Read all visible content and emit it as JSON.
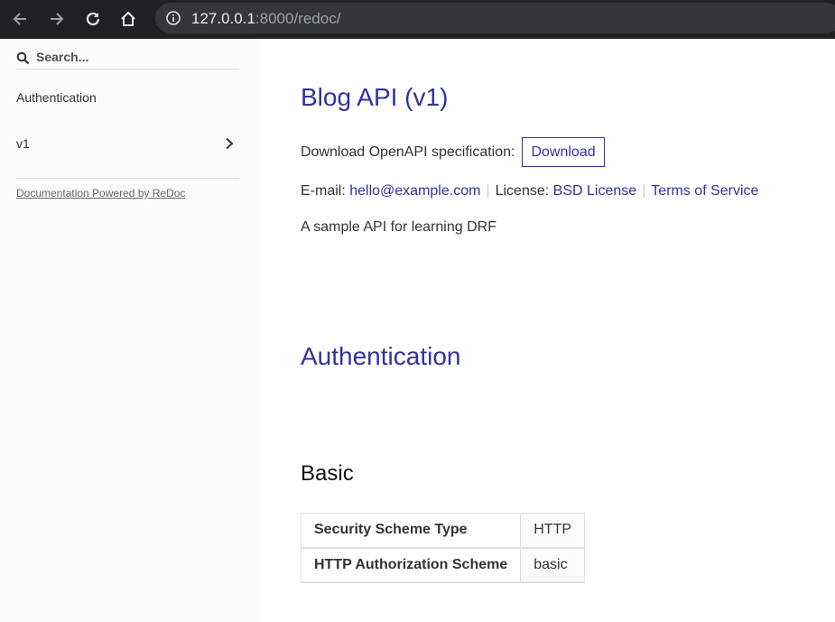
{
  "browser": {
    "url_host": "127.0.0.1",
    "url_rest": ":8000/redoc/"
  },
  "sidebar": {
    "search": {
      "placeholder": "Search..."
    },
    "items": [
      {
        "label": "Authentication"
      },
      {
        "label": "v1"
      }
    ],
    "powered_by": "Documentation Powered by ReDoc"
  },
  "main": {
    "title": "Blog API (v1)",
    "download_label": "Download OpenAPI specification:",
    "download_button": "Download",
    "email_label": "E-mail:",
    "email": "hello@example.com",
    "license_label": "License:",
    "license": "BSD License",
    "terms": "Terms of Service",
    "description": "A sample API for learning DRF",
    "section_title": "Authentication",
    "scheme_title": "Basic",
    "scheme_rows": [
      {
        "key": "Security Scheme Type",
        "value": "HTTP"
      },
      {
        "key": "HTTP Authorization Scheme",
        "value": "basic"
      }
    ]
  },
  "colors": {
    "accent": "#32329f",
    "sidebar_bg": "#fafafa",
    "chrome_bg": "#202124"
  },
  "icons": [
    "back-icon",
    "forward-icon",
    "reload-icon",
    "home-icon",
    "info-icon",
    "search-icon",
    "chevron-right-icon"
  ]
}
